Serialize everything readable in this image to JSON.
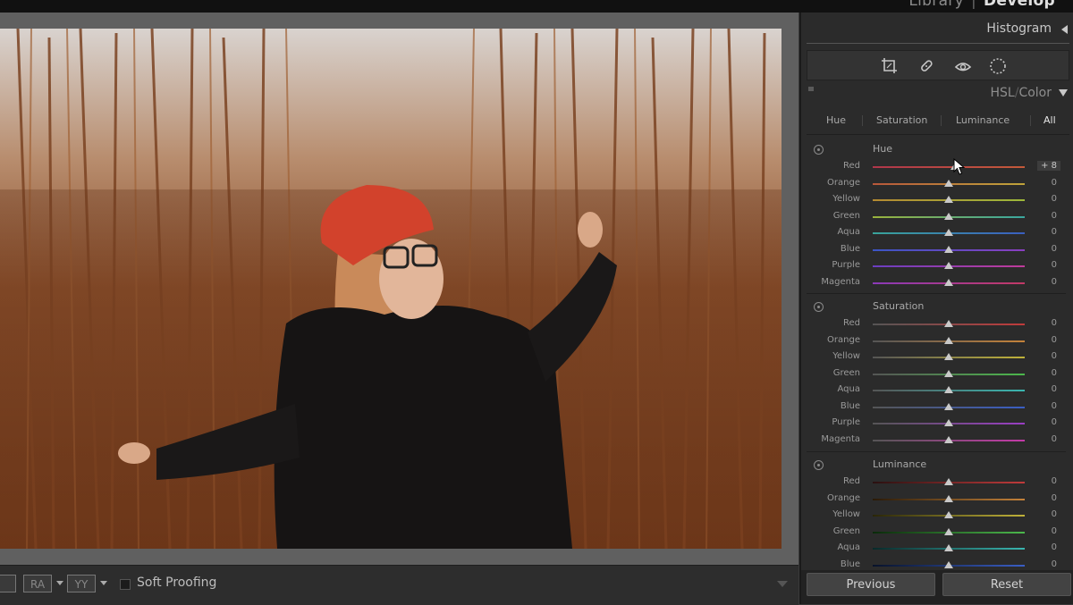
{
  "modules": {
    "library": "Library",
    "develop": "Develop",
    "separator": "|"
  },
  "toolbar": {
    "ra_label": "RA",
    "yy_label": "YY",
    "soft_proofing": "Soft Proofing"
  },
  "histogram": {
    "title": "Histogram"
  },
  "hsl": {
    "title_hsl": "HSL",
    "title_sep": "/",
    "title_color": "Color",
    "tabs": [
      {
        "label": "Hue"
      },
      {
        "label": "Saturation"
      },
      {
        "label": "Luminance"
      },
      {
        "label": "All"
      }
    ],
    "groups": [
      {
        "title": "Hue",
        "rows": [
          {
            "label": "Red",
            "value": "+ 8",
            "level": 8
          },
          {
            "label": "Orange",
            "value": "0",
            "level": 0
          },
          {
            "label": "Yellow",
            "value": "0",
            "level": 0
          },
          {
            "label": "Green",
            "value": "0",
            "level": 0
          },
          {
            "label": "Aqua",
            "value": "0",
            "level": 0
          },
          {
            "label": "Blue",
            "value": "0",
            "level": 0
          },
          {
            "label": "Purple",
            "value": "0",
            "level": 0
          },
          {
            "label": "Magenta",
            "value": "0",
            "level": 0
          }
        ]
      },
      {
        "title": "Saturation",
        "rows": [
          {
            "label": "Red",
            "value": "0",
            "level": 0
          },
          {
            "label": "Orange",
            "value": "0",
            "level": 0
          },
          {
            "label": "Yellow",
            "value": "0",
            "level": 0
          },
          {
            "label": "Green",
            "value": "0",
            "level": 0
          },
          {
            "label": "Aqua",
            "value": "0",
            "level": 0
          },
          {
            "label": "Blue",
            "value": "0",
            "level": 0
          },
          {
            "label": "Purple",
            "value": "0",
            "level": 0
          },
          {
            "label": "Magenta",
            "value": "0",
            "level": 0
          }
        ]
      },
      {
        "title": "Luminance",
        "rows": [
          {
            "label": "Red",
            "value": "0",
            "level": 0
          },
          {
            "label": "Orange",
            "value": "0",
            "level": 0
          },
          {
            "label": "Yellow",
            "value": "0",
            "level": 0
          },
          {
            "label": "Green",
            "value": "0",
            "level": 0
          },
          {
            "label": "Aqua",
            "value": "0",
            "level": 0
          },
          {
            "label": "Blue",
            "value": "0",
            "level": 0
          }
        ]
      }
    ]
  },
  "footer": {
    "previous": "Previous",
    "reset": "Reset"
  },
  "colors": {
    "panel_bg": "#2b2b2b",
    "accent_text": "#e6e6e6",
    "hue_tracks": {
      "Red": [
        "#b0364a",
        "#c45a3a"
      ],
      "Orange": [
        "#b8573a",
        "#bfa43a"
      ],
      "Yellow": [
        "#b58a32",
        "#9db83a"
      ],
      "Green": [
        "#9ab23c",
        "#3aa8a0"
      ],
      "Aqua": [
        "#39a49a",
        "#3a5fc0"
      ],
      "Blue": [
        "#3b55c4",
        "#8a3fc0"
      ],
      "Purple": [
        "#6a3ec2",
        "#c03b9a"
      ],
      "Magenta": [
        "#8b3ab8",
        "#c23a66"
      ]
    },
    "sat_tracks": {
      "Red": [
        "#555555",
        "#c03b3b"
      ],
      "Orange": [
        "#555555",
        "#c4823a"
      ],
      "Yellow": [
        "#555555",
        "#c0b23a"
      ],
      "Green": [
        "#555555",
        "#4cb84c"
      ],
      "Aqua": [
        "#555555",
        "#3ab6b0"
      ],
      "Blue": [
        "#555555",
        "#3a5ec4"
      ],
      "Purple": [
        "#555555",
        "#9a3ec4"
      ],
      "Magenta": [
        "#555555",
        "#c43aa8"
      ]
    },
    "lum_tracks": {
      "Red": [
        "#2a1010",
        "#c03b3b"
      ],
      "Orange": [
        "#2a1a08",
        "#c4823a"
      ],
      "Yellow": [
        "#2a2608",
        "#c0b23a"
      ],
      "Green": [
        "#0a2a0a",
        "#4cb84c"
      ],
      "Aqua": [
        "#082a2a",
        "#3ab6b0"
      ],
      "Blue": [
        "#08122a",
        "#3a5ec4"
      ]
    }
  },
  "icons": [
    "crop-icon",
    "heal-brush-icon",
    "red-eye-icon",
    "radial-filter-icon",
    "target-adjust-icon",
    "pointer-cursor-icon"
  ]
}
